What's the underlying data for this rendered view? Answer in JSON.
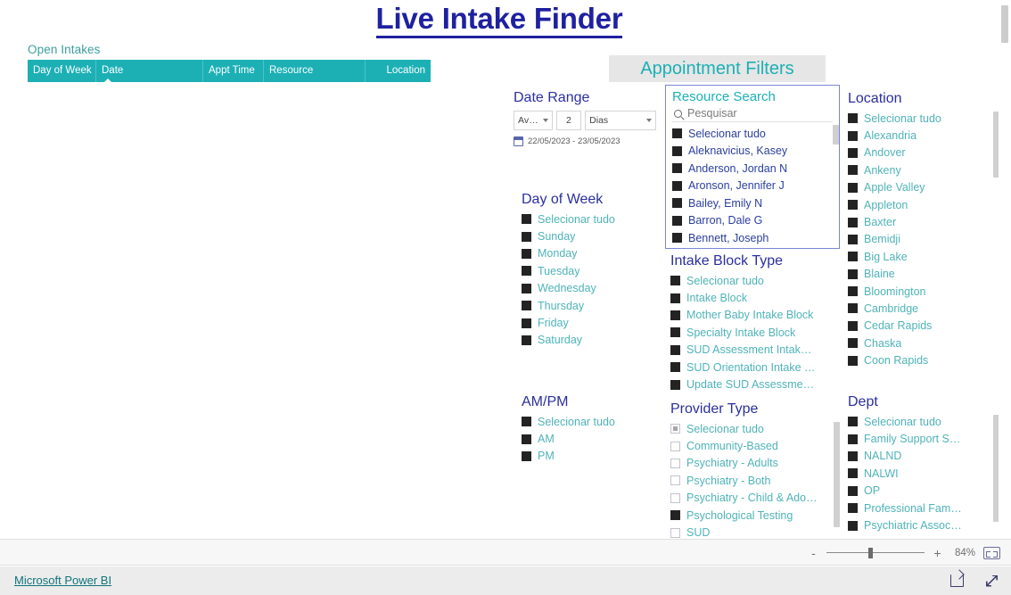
{
  "report": {
    "title": "Live Intake Finder"
  },
  "open_intakes": {
    "title": "Open Intakes",
    "columns": [
      "Day of Week",
      "Date",
      "Appt Time",
      "Resource",
      "Location"
    ],
    "sorted_column": "Date",
    "sort_direction": "ascending",
    "rows": []
  },
  "filters": {
    "banner": "Appointment Filters",
    "date_range": {
      "title": "Date Range",
      "relation": "Av…",
      "amount": "2",
      "unit": "Dias",
      "range_text": "22/05/2023 - 23/05/2023"
    },
    "day_of_week": {
      "title": "Day of Week",
      "items": [
        {
          "label": "Selecionar tudo",
          "state": "checked"
        },
        {
          "label": "Sunday",
          "state": "checked"
        },
        {
          "label": "Monday",
          "state": "checked"
        },
        {
          "label": "Tuesday",
          "state": "checked"
        },
        {
          "label": "Wednesday",
          "state": "checked"
        },
        {
          "label": "Thursday",
          "state": "checked"
        },
        {
          "label": "Friday",
          "state": "checked"
        },
        {
          "label": "Saturday",
          "state": "checked"
        }
      ]
    },
    "ampm": {
      "title": "AM/PM",
      "items": [
        {
          "label": "Selecionar tudo",
          "state": "checked"
        },
        {
          "label": "AM",
          "state": "checked"
        },
        {
          "label": "PM",
          "state": "checked"
        }
      ]
    },
    "resource_search": {
      "title": "Resource Search",
      "search_placeholder": "Pesquisar",
      "search_value": "",
      "items": [
        {
          "label": "Selecionar tudo",
          "state": "checked"
        },
        {
          "label": "Aleknavicius, Kasey",
          "state": "checked"
        },
        {
          "label": "Anderson, Jordan N",
          "state": "checked"
        },
        {
          "label": "Aronson, Jennifer J",
          "state": "checked"
        },
        {
          "label": "Bailey, Emily N",
          "state": "checked"
        },
        {
          "label": "Barron, Dale G",
          "state": "checked"
        },
        {
          "label": "Bennett, Joseph",
          "state": "checked"
        }
      ]
    },
    "intake_block_type": {
      "title": "Intake Block Type",
      "items": [
        {
          "label": "Selecionar tudo",
          "state": "checked"
        },
        {
          "label": "Intake Block",
          "state": "checked"
        },
        {
          "label": "Mother Baby Intake Block",
          "state": "checked"
        },
        {
          "label": "Specialty Intake Block",
          "state": "checked"
        },
        {
          "label": "SUD Assessment Intak…",
          "state": "checked"
        },
        {
          "label": "SUD Orientation Intake …",
          "state": "checked"
        },
        {
          "label": "Update SUD Assessme…",
          "state": "checked"
        }
      ]
    },
    "provider_type": {
      "title": "Provider Type",
      "items": [
        {
          "label": "Selecionar tudo",
          "state": "partial"
        },
        {
          "label": "Community-Based",
          "state": "unchecked"
        },
        {
          "label": "Psychiatry - Adults",
          "state": "unchecked"
        },
        {
          "label": "Psychiatry - Both",
          "state": "unchecked"
        },
        {
          "label": "Psychiatry - Child & Ado…",
          "state": "unchecked"
        },
        {
          "label": "Psychological Testing",
          "state": "checked"
        },
        {
          "label": "SUD",
          "state": "unchecked"
        }
      ]
    },
    "location": {
      "title": "Location",
      "items": [
        {
          "label": "Selecionar tudo",
          "state": "checked"
        },
        {
          "label": "Alexandria",
          "state": "checked"
        },
        {
          "label": "Andover",
          "state": "checked"
        },
        {
          "label": "Ankeny",
          "state": "checked"
        },
        {
          "label": "Apple Valley",
          "state": "checked"
        },
        {
          "label": "Appleton",
          "state": "checked"
        },
        {
          "label": "Baxter",
          "state": "checked"
        },
        {
          "label": "Bemidji",
          "state": "checked"
        },
        {
          "label": "Big Lake",
          "state": "checked"
        },
        {
          "label": "Blaine",
          "state": "checked"
        },
        {
          "label": "Bloomington",
          "state": "checked"
        },
        {
          "label": "Cambridge",
          "state": "checked"
        },
        {
          "label": "Cedar Rapids",
          "state": "checked"
        },
        {
          "label": "Chaska",
          "state": "checked"
        },
        {
          "label": "Coon Rapids",
          "state": "checked"
        }
      ]
    },
    "dept": {
      "title": "Dept",
      "items": [
        {
          "label": "Selecionar tudo",
          "state": "checked"
        },
        {
          "label": "Family Support S…",
          "state": "checked"
        },
        {
          "label": "NALND",
          "state": "checked"
        },
        {
          "label": "NALWI",
          "state": "checked"
        },
        {
          "label": "OP",
          "state": "checked"
        },
        {
          "label": "Professional Fam…",
          "state": "checked"
        },
        {
          "label": "Psychiatric Assoc…",
          "state": "checked"
        }
      ]
    }
  },
  "status_bar": {
    "zoom_out_label": "-",
    "zoom_in_label": "+",
    "zoom_value": "84%",
    "fit_icon": "fit-to-page-icon"
  },
  "footer": {
    "powerbi_link": "Microsoft Power BI",
    "share_icon": "share-icon",
    "fullscreen_icon": "expand-icon"
  },
  "colors": {
    "teal": "#1cb0b5",
    "title_blue": "#1f21a0",
    "header_teal": "#1cb0b5",
    "resource_border": "#7b86d6",
    "link_teal": "#10737a"
  }
}
